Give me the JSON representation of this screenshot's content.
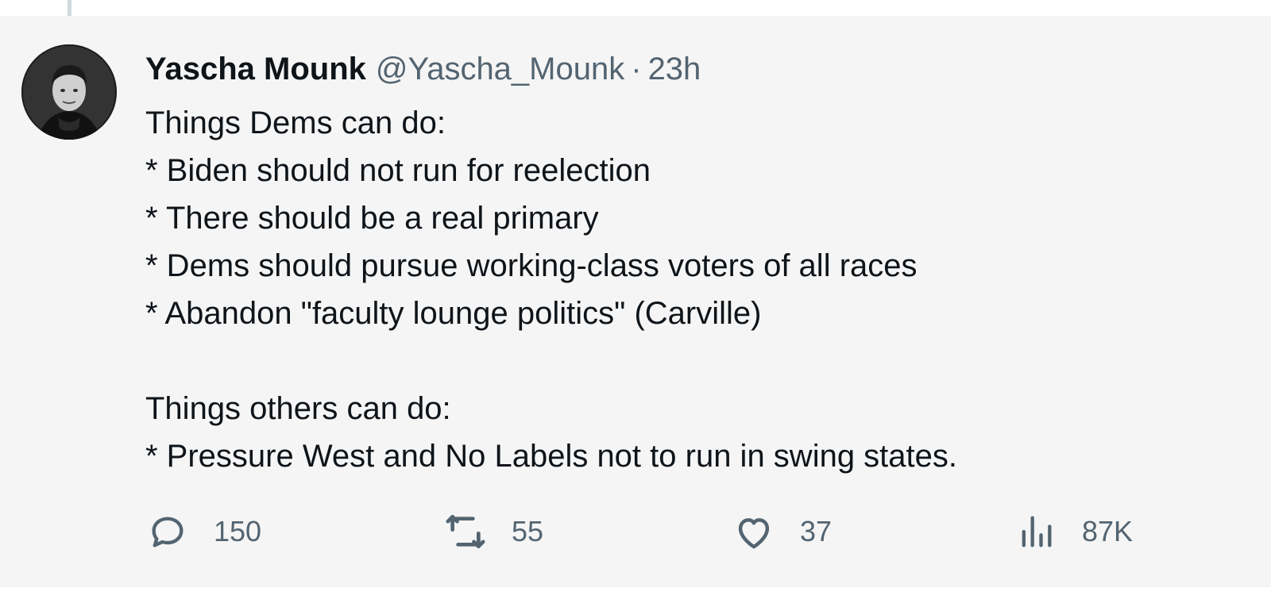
{
  "tweet": {
    "author": {
      "name": "Yascha Mounk",
      "handle": "@Yascha_Mounk"
    },
    "separator": "·",
    "timestamp": "23h",
    "lines": [
      "Things Dems can do:",
      "* Biden should not run for reelection",
      "* There should be a real primary",
      "* Dems should pursue working-class voters of all races",
      "* Abandon \"faculty lounge politics\" (Carville)",
      "",
      "Things others can do:",
      "* Pressure West and No Labels not to run in swing states."
    ],
    "actions": {
      "replies": {
        "icon": "reply-icon",
        "count": "150"
      },
      "reposts": {
        "icon": "repost-icon",
        "count": "55"
      },
      "likes": {
        "icon": "like-icon",
        "count": "37"
      },
      "views": {
        "icon": "views-icon",
        "count": "87K"
      }
    }
  },
  "colors": {
    "background": "#f5f5f5",
    "text_primary": "#0f1419",
    "text_secondary": "#536471",
    "thread_line": "#cfd9de"
  }
}
